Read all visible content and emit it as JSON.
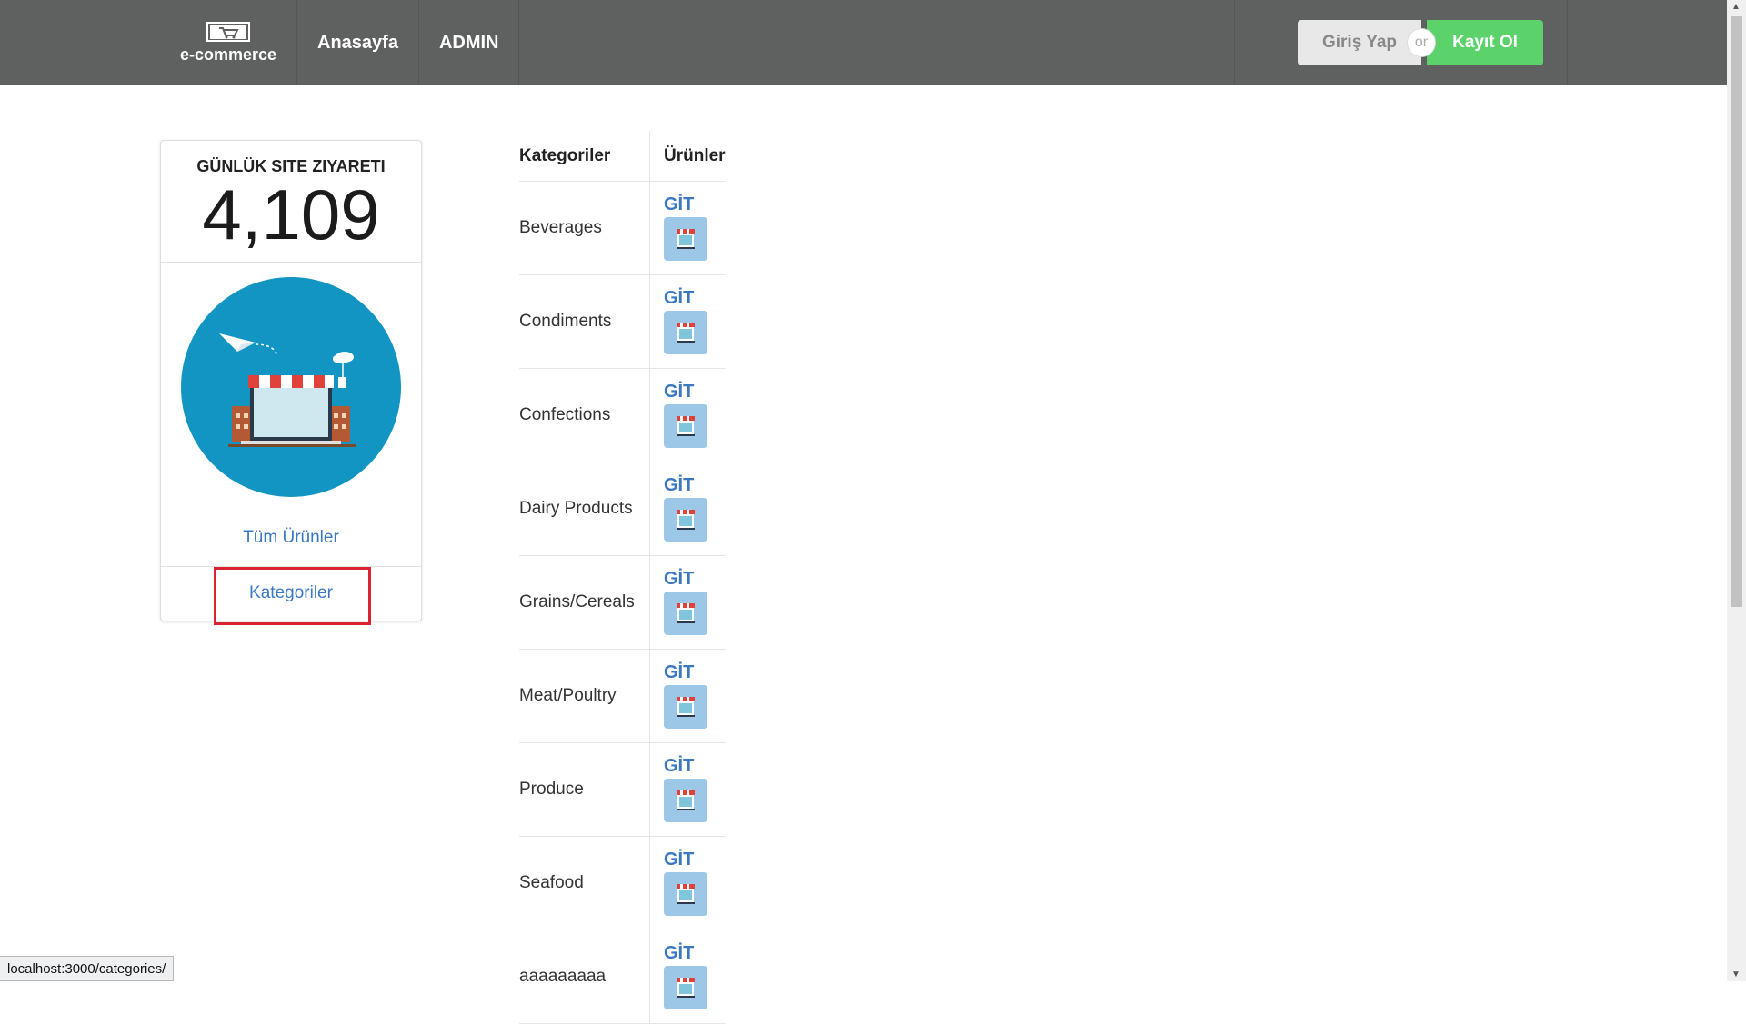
{
  "nav": {
    "brand": "e-commerce",
    "links": [
      "Anasayfa",
      "ADMIN"
    ],
    "login": "Giriş Yap",
    "or": "or",
    "register": "Kayıt Ol"
  },
  "card": {
    "label": "GÜNLÜK SITE ZIYARETI",
    "value": "4,109",
    "link_all": "Tüm Ürünler",
    "link_categories": "Kategoriler"
  },
  "table": {
    "headers": [
      "Kategoriler",
      "Ürünler"
    ],
    "go_label": "GİT",
    "rows": [
      "Beverages",
      "Condiments",
      "Confections",
      "Dairy Products",
      "Grains/Cereals",
      "Meat/Poultry",
      "Produce",
      "Seafood",
      "aaaaaaaaa"
    ]
  },
  "status_url": "localhost:3000/categories/",
  "colors": {
    "nav_bg": "#5f6060",
    "register": "#5bd36a",
    "link": "#3b78c2",
    "highlight": "#d9232e",
    "illustration_bg": "#1395c4"
  }
}
